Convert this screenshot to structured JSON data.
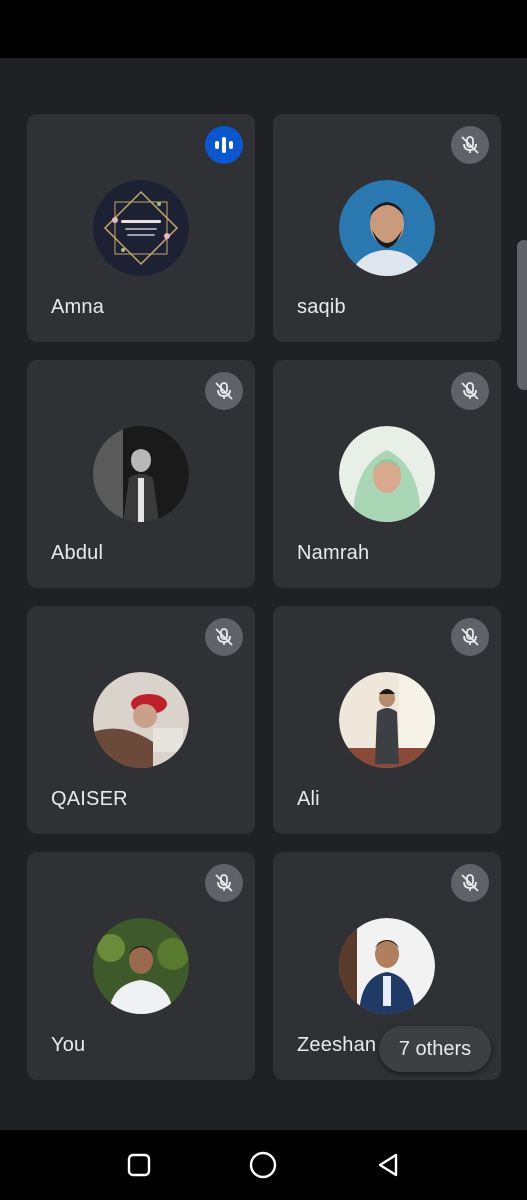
{
  "participants": [
    {
      "name": "Amna",
      "mic": "speaking",
      "avatar": "avatar-logo-icon"
    },
    {
      "name": "saqib",
      "mic": "muted",
      "avatar": "avatar-photo-icon"
    },
    {
      "name": "Abdul",
      "mic": "muted",
      "avatar": "avatar-photo-icon"
    },
    {
      "name": "Namrah",
      "mic": "muted",
      "avatar": "avatar-photo-icon"
    },
    {
      "name": "QAISER",
      "mic": "muted",
      "avatar": "avatar-photo-icon"
    },
    {
      "name": "Ali",
      "mic": "muted",
      "avatar": "avatar-photo-icon"
    },
    {
      "name": "You",
      "mic": "muted",
      "avatar": "avatar-photo-icon"
    },
    {
      "name": "Zeeshan",
      "mic": "muted",
      "avatar": "avatar-photo-icon"
    }
  ],
  "others_chip": {
    "label": "7 others"
  },
  "navigation": {
    "items": [
      "recents-square-icon",
      "home-circle-icon",
      "back-triangle-icon"
    ]
  },
  "colors": {
    "background": "#202124",
    "tile": "#303134",
    "speaking_accent": "#0b57d0",
    "muted_badge": "#5f6368",
    "text": "#e8eaed"
  }
}
